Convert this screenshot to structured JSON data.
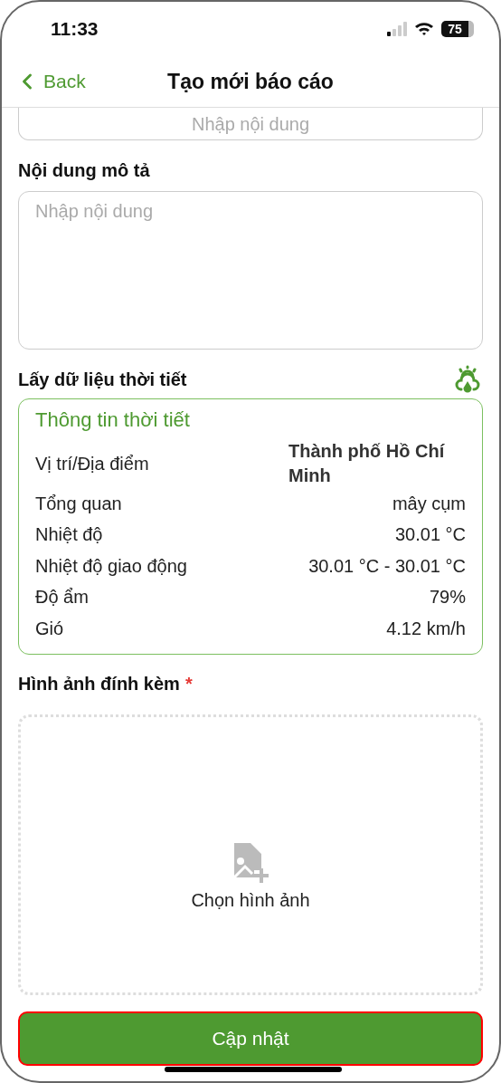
{
  "status_bar": {
    "time": "11:33",
    "battery": "75"
  },
  "nav": {
    "back": "Back",
    "title": "Tạo mới báo cáo"
  },
  "previous_field": {
    "placeholder": "Nhập nội dung"
  },
  "description": {
    "label": "Nội dung mô tả",
    "placeholder": "Nhập nội dung"
  },
  "weather": {
    "label": "Lấy dữ liệu thời tiết",
    "title": "Thông tin thời tiết",
    "rows": [
      {
        "label": "Vị trí/Địa điểm",
        "value": "Thành phố Hồ Chí Minh",
        "kind": "emphasis"
      },
      {
        "label": "Tổng quan",
        "value": "mây cụm",
        "kind": "plain"
      },
      {
        "label": "Nhiệt độ",
        "value": "30.01 °C",
        "kind": "plain"
      },
      {
        "label": "Nhiệt độ giao động",
        "value": "30.01 °C - 30.01 °C",
        "kind": "plain"
      },
      {
        "label": "Độ ẩm",
        "value": "79%",
        "kind": "plain"
      },
      {
        "label": "Gió",
        "value": "4.12 km/h",
        "kind": "plain"
      }
    ]
  },
  "attachments": {
    "label": "Hình ảnh đính kèm",
    "required": true,
    "required_mark": "*",
    "picker": "Chọn hình ảnh"
  },
  "submit": {
    "label": "Cập nhật"
  }
}
